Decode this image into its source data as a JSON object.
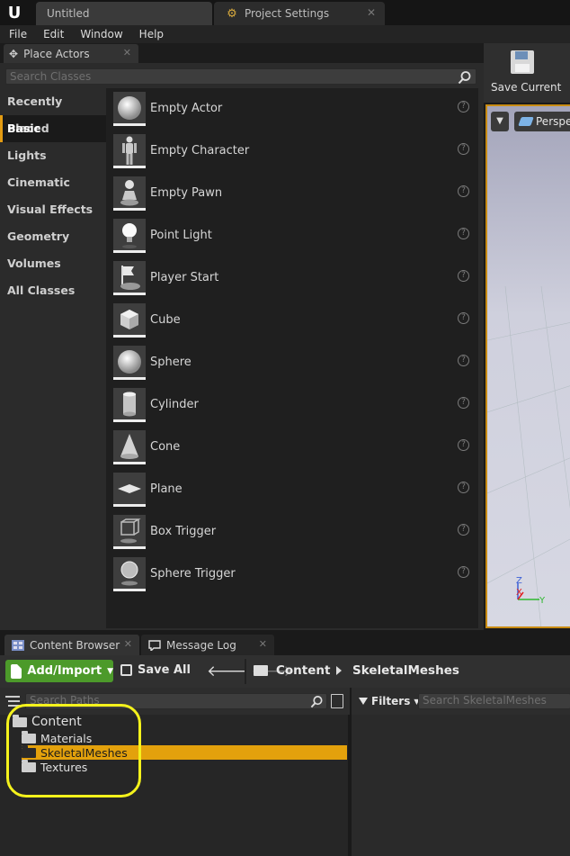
{
  "window_tabs": [
    {
      "label": "Untitled"
    },
    {
      "label": "Project Settings"
    }
  ],
  "menu": [
    "File",
    "Edit",
    "Window",
    "Help"
  ],
  "place_actors": {
    "tab_label": "Place Actors",
    "search_placeholder": "Search Classes",
    "categories": [
      {
        "label": "Recently Placed"
      },
      {
        "label": "Basic",
        "selected": true
      },
      {
        "label": "Lights"
      },
      {
        "label": "Cinematic"
      },
      {
        "label": "Visual Effects"
      },
      {
        "label": "Geometry"
      },
      {
        "label": "Volumes"
      },
      {
        "label": "All Classes"
      }
    ],
    "actors": [
      {
        "label": "Empty Actor",
        "icon": "sphere-icon"
      },
      {
        "label": "Empty Character",
        "icon": "character-icon"
      },
      {
        "label": "Empty Pawn",
        "icon": "pawn-icon"
      },
      {
        "label": "Point Light",
        "icon": "light-bulb-icon"
      },
      {
        "label": "Player Start",
        "icon": "flag-icon"
      },
      {
        "label": "Cube",
        "icon": "cube-icon"
      },
      {
        "label": "Sphere",
        "icon": "sphere-icon"
      },
      {
        "label": "Cylinder",
        "icon": "cylinder-icon"
      },
      {
        "label": "Cone",
        "icon": "cone-icon"
      },
      {
        "label": "Plane",
        "icon": "plane-icon"
      },
      {
        "label": "Box Trigger",
        "icon": "box-trigger-icon"
      },
      {
        "label": "Sphere Trigger",
        "icon": "sphere-trigger-icon"
      }
    ]
  },
  "viewport": {
    "save_label": "Save Current",
    "view_mode": "Perspective",
    "axis_labels": {
      "z": "Z",
      "x": "X",
      "y": "Y"
    },
    "accent": "#c88b12"
  },
  "bottom_tabs": [
    {
      "label": "Content Browser"
    },
    {
      "label": "Message Log"
    }
  ],
  "content_browser": {
    "add_import_label": "Add/Import",
    "save_all_label": "Save All",
    "breadcrumb": [
      "Content",
      "SkeletalMeshes"
    ],
    "path_search_placeholder": "Search Paths",
    "filters_label": "Filters",
    "asset_search_placeholder": "Search SkeletalMeshes",
    "tree": {
      "root": "Content",
      "children": [
        {
          "label": "Materials"
        },
        {
          "label": "SkeletalMeshes",
          "selected": true
        },
        {
          "label": "Textures"
        }
      ]
    },
    "highlight_color": "#f4f21c",
    "selection_color": "#e3a10c",
    "add_button_color": "#4c9a2a"
  }
}
